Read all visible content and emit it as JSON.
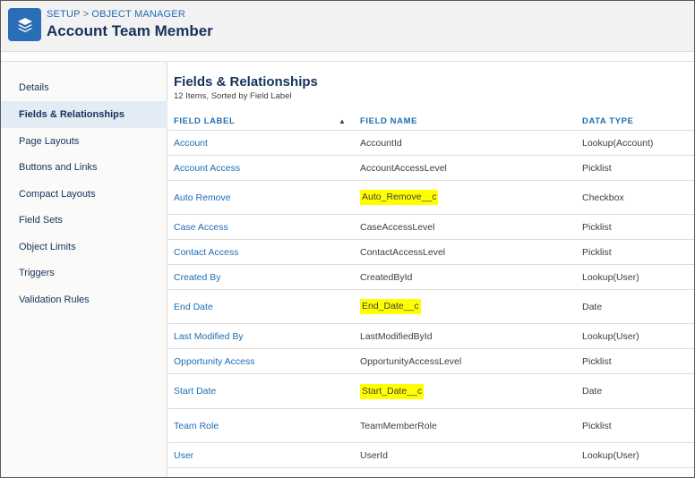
{
  "breadcrumb": {
    "setup": "SETUP",
    "separator": ">",
    "object_manager": "OBJECT MANAGER"
  },
  "page_title": "Account Team Member",
  "sidebar": {
    "items": [
      {
        "label": "Details",
        "active": false
      },
      {
        "label": "Fields & Relationships",
        "active": true
      },
      {
        "label": "Page Layouts",
        "active": false
      },
      {
        "label": "Buttons and Links",
        "active": false
      },
      {
        "label": "Compact Layouts",
        "active": false
      },
      {
        "label": "Field Sets",
        "active": false
      },
      {
        "label": "Object Limits",
        "active": false
      },
      {
        "label": "Triggers",
        "active": false
      },
      {
        "label": "Validation Rules",
        "active": false
      }
    ]
  },
  "main": {
    "title": "Fields & Relationships",
    "subtitle": "12 Items, Sorted by Field Label",
    "columns": [
      "FIELD LABEL",
      "FIELD NAME",
      "DATA TYPE"
    ],
    "rows": [
      {
        "label": "Account",
        "name": "AccountId",
        "type": "Lookup(Account)",
        "highlight": false
      },
      {
        "label": "Account Access",
        "name": "AccountAccessLevel",
        "type": "Picklist",
        "highlight": false
      },
      {
        "label": "Auto Remove",
        "name": "Auto_Remove__c",
        "type": "Checkbox",
        "highlight": true
      },
      {
        "label": "Case Access",
        "name": "CaseAccessLevel",
        "type": "Picklist",
        "highlight": false
      },
      {
        "label": "Contact Access",
        "name": "ContactAccessLevel",
        "type": "Picklist",
        "highlight": false
      },
      {
        "label": "Created By",
        "name": "CreatedById",
        "type": "Lookup(User)",
        "highlight": false
      },
      {
        "label": "End Date",
        "name": "End_Date__c",
        "type": "Date",
        "highlight": true
      },
      {
        "label": "Last Modified By",
        "name": "LastModifiedById",
        "type": "Lookup(User)",
        "highlight": false
      },
      {
        "label": "Opportunity Access",
        "name": "OpportunityAccessLevel",
        "type": "Picklist",
        "highlight": false
      },
      {
        "label": "Start Date",
        "name": "Start_Date__c",
        "type": "Date",
        "highlight": true
      },
      {
        "label": "Team Role",
        "name": "TeamMemberRole",
        "type": "Picklist",
        "highlight": false
      },
      {
        "label": "User",
        "name": "UserId",
        "type": "Lookup(User)",
        "highlight": false
      }
    ]
  },
  "colors": {
    "accent": "#1b6eb5",
    "logo_bg": "#2a6db7",
    "highlight": "#ffff00",
    "active_nav": "#e3ebf5"
  },
  "icons": {
    "logo": "layers-icon",
    "sort": "sort-ascending-icon"
  }
}
